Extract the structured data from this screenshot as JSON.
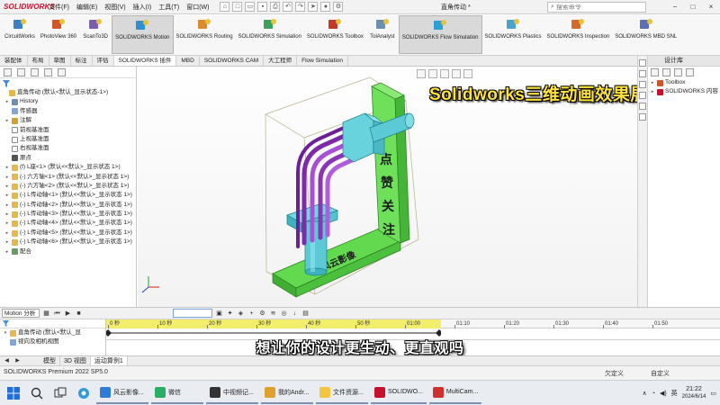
{
  "title_bar": {
    "logo": "SOLIDWORKS",
    "menus": [
      "文件(F)",
      "编辑(E)",
      "视图(V)",
      "插入(I)",
      "工具(T)",
      "窗口(W)"
    ],
    "document_title": "直角传动 *",
    "search_placeholder": "搜索命令",
    "controls": [
      "−",
      "□",
      "×"
    ]
  },
  "toolbar": {
    "buttons": [
      {
        "label": "CircuitWorks",
        "icon": "circuitworks-icon"
      },
      {
        "label": "PhotoView 360",
        "icon": "photoview-icon"
      },
      {
        "label": "ScanTo3D",
        "icon": "scanto3d-icon"
      },
      {
        "label": "SOLIDWORKS Motion",
        "icon": "motion-icon",
        "active": true
      },
      {
        "label": "SOLIDWORKS Routing",
        "icon": "routing-icon"
      },
      {
        "label": "SOLIDWORKS Simulation",
        "icon": "simulation-icon"
      },
      {
        "label": "SOLIDWORKS Toolbox",
        "icon": "toolbox-icon"
      },
      {
        "label": "TolAnalyst",
        "icon": "tolanalyst-icon"
      },
      {
        "label": "SOLIDWORKS Flow Simulation",
        "icon": "flow-simulation-icon",
        "active": true
      },
      {
        "label": "SOLIDWORKS Plastics",
        "icon": "plastics-icon"
      },
      {
        "label": "SOLIDWORKS Inspection",
        "icon": "inspection-icon"
      },
      {
        "label": "SOLIDWORKS MBD SNL",
        "icon": "mbd-icon"
      }
    ]
  },
  "tabs": [
    "装配体",
    "布局",
    "草图",
    "标注",
    "评估",
    "SOLIDWORKS 插件",
    "MBD",
    "SOLIDWORKS CAM",
    "大工程师",
    "Flow Simulation"
  ],
  "active_tab": 5,
  "overlay_title": "Solidworks三维动画效果展示",
  "model_text": {
    "plate_vertical": [
      "点",
      "赞",
      "关",
      "注"
    ],
    "plate_horizontal": "风云影像"
  },
  "feature_tree": {
    "filter_icon": "filter-icon",
    "items": [
      {
        "label": "直角传动 (默认<默认_显示状态-1>)",
        "icon": "assembly-icon",
        "level": 0,
        "arrow": false
      },
      {
        "label": "History",
        "icon": "history-icon",
        "level": 1,
        "arrow": true
      },
      {
        "label": "传感器",
        "icon": "sensor-icon",
        "level": 1,
        "arrow": false
      },
      {
        "label": "注解",
        "icon": "annotation-icon",
        "level": 1,
        "arrow": true
      },
      {
        "label": "前视基准面",
        "icon": "plane-icon",
        "level": 1,
        "arrow": false
      },
      {
        "label": "上视基准面",
        "icon": "plane-icon",
        "level": 1,
        "arrow": false
      },
      {
        "label": "右视基准面",
        "icon": "plane-icon",
        "level": 1,
        "arrow": false
      },
      {
        "label": "原点",
        "icon": "origin-icon",
        "level": 1,
        "arrow": false
      },
      {
        "label": "(f) L座<1> (默认<<默认>_显示状态 1>)",
        "icon": "part-icon",
        "level": 1,
        "arrow": true
      },
      {
        "label": "(-) 六方轴<1> (默认<<默认>_显示状态 1>)",
        "icon": "part-icon",
        "level": 1,
        "arrow": true
      },
      {
        "label": "(-) 六方轴<2> (默认<<默认>_显示状态 1>)",
        "icon": "part-icon",
        "level": 1,
        "arrow": true
      },
      {
        "label": "(-) L传动轴<1> (默认<<默认>_显示状态 1>)",
        "icon": "part-icon",
        "level": 1,
        "arrow": true
      },
      {
        "label": "(-) L传动轴<2> (默认<<默认>_显示状态 1>)",
        "icon": "part-icon",
        "level": 1,
        "arrow": true
      },
      {
        "label": "(-) L传动轴<3> (默认<<默认>_显示状态 1>)",
        "icon": "part-icon",
        "level": 1,
        "arrow": true
      },
      {
        "label": "(-) L传动轴<4> (默认<<默认>_显示状态 1>)",
        "icon": "part-icon",
        "level": 1,
        "arrow": true
      },
      {
        "label": "(-) L传动轴<5> (默认<<默认>_显示状态 1>)",
        "icon": "part-icon",
        "level": 1,
        "arrow": true
      },
      {
        "label": "(-) L传动轴<6> (默认<<默认>_显示状态 1>)",
        "icon": "part-icon",
        "level": 1,
        "arrow": true
      },
      {
        "label": "配合",
        "icon": "mates-icon",
        "level": 1,
        "arrow": true
      }
    ]
  },
  "right_panel": {
    "title": "设计库",
    "items": [
      {
        "label": "Toolbox",
        "icon": "toolbox-icon"
      },
      {
        "label": "SOLIDWORKS 内容",
        "icon": "solidworks-content-icon"
      }
    ]
  },
  "motion_manager": {
    "study_type": "Motion 分析",
    "time_field": "",
    "tree_items": [
      "直角传动 (默认<默认_显",
      "视向及相机视图"
    ],
    "ticks": [
      "0 秒",
      "10 秒",
      "20 秒",
      "30 秒",
      "40 秒",
      "50 秒",
      "01:00",
      "01:10",
      "01:20",
      "01:30",
      "01:40",
      "01:50"
    ]
  },
  "subtitle": "想让你的设计更生动、更直观吗",
  "bottom_tabs": [
    "模型",
    "3D 视图",
    "运动算例1"
  ],
  "active_bottom_tab": 2,
  "status_bar": {
    "left": "SOLIDWORKS Premium 2022 SP5.0",
    "right": [
      "欠定义",
      "自定义"
    ]
  },
  "taskbar": {
    "apps": [
      {
        "label": "风云影像...",
        "color": "#2f7bd8"
      },
      {
        "label": "微信",
        "color": "#2aae67"
      },
      {
        "label": "中视频记...",
        "color": "#333333"
      },
      {
        "label": "我的Andr...",
        "color": "#e0a030"
      },
      {
        "label": "文件资源...",
        "color": "#f4c542"
      },
      {
        "label": "SOLIDWO...",
        "color": "#c8102e"
      },
      {
        "label": "MultiCam...",
        "color": "#d03030"
      }
    ],
    "tray_lang": "英",
    "time": "21:22",
    "date": "2024/6/14"
  }
}
